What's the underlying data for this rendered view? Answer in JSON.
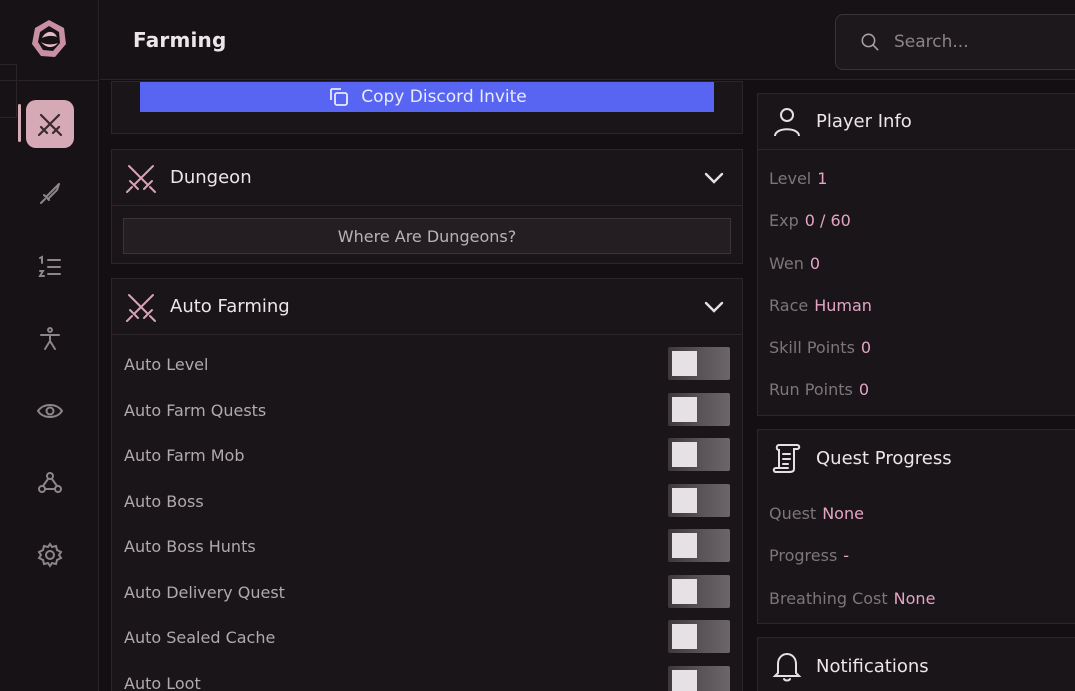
{
  "header": {
    "title": "Farming",
    "search_placeholder": "Search..."
  },
  "sidebar": {
    "items": [
      {
        "name": "swords",
        "active": true
      },
      {
        "name": "sword",
        "active": false
      },
      {
        "name": "list",
        "active": false
      },
      {
        "name": "person",
        "active": false
      },
      {
        "name": "eye",
        "active": false
      },
      {
        "name": "webhook",
        "active": false
      },
      {
        "name": "gear",
        "active": false
      }
    ]
  },
  "discord": {
    "label": "Copy Discord Invite"
  },
  "dungeon": {
    "title": "Dungeon",
    "button": "Where Are Dungeons?"
  },
  "auto_farming": {
    "title": "Auto Farming",
    "toggles": [
      {
        "label": "Auto Level",
        "on": false
      },
      {
        "label": "Auto Farm Quests",
        "on": false
      },
      {
        "label": "Auto Farm Mob",
        "on": false
      },
      {
        "label": "Auto Boss",
        "on": false
      },
      {
        "label": "Auto Boss Hunts",
        "on": false
      },
      {
        "label": "Auto Delivery Quest",
        "on": false
      },
      {
        "label": "Auto Sealed Cache",
        "on": false
      },
      {
        "label": "Auto Loot",
        "on": false
      }
    ]
  },
  "player_info": {
    "title": "Player Info",
    "rows": [
      {
        "label": "Level",
        "value": "1"
      },
      {
        "label": "Exp",
        "value": "0 / 60"
      },
      {
        "label": "Wen",
        "value": "0"
      },
      {
        "label": "Race",
        "value": "Human"
      },
      {
        "label": "Skill Points",
        "value": "0"
      },
      {
        "label": "Run Points",
        "value": "0"
      }
    ]
  },
  "quest_progress": {
    "title": "Quest Progress",
    "rows": [
      {
        "label": "Quest",
        "value": "None"
      },
      {
        "label": "Progress",
        "value": "-"
      },
      {
        "label": "Breathing Cost",
        "value": "None"
      }
    ]
  },
  "notifications": {
    "title": "Notifications"
  },
  "colors": {
    "accent": "#d6a9b6",
    "value_pink": "#e4a5c6",
    "discord_blue": "#5865f2",
    "background": "#130f12"
  }
}
